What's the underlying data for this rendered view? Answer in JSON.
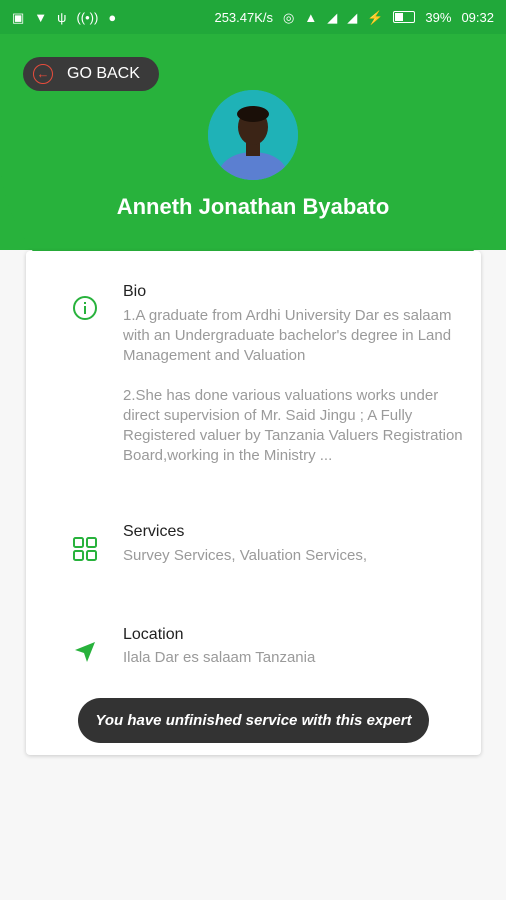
{
  "status_bar": {
    "network_speed": "253.47K/s",
    "battery_percent": "39%",
    "time": "09:32",
    "battery_level": 0.39,
    "left_icons": [
      "laptop-icon",
      "shield-icon",
      "usb-icon",
      "hotspot-icon",
      "android-icon"
    ],
    "right_icons": [
      "wifi-hotspot-icon",
      "bell-icon",
      "signal-icon",
      "signal-hd-icon",
      "charging-icon",
      "battery-icon"
    ]
  },
  "header": {
    "back_label": "GO BACK",
    "name": "Anneth Jonathan Byabato",
    "avatar_icon": "profile-photo"
  },
  "profile": {
    "bio": {
      "title": "Bio",
      "icon": "info-icon",
      "paragraph1": "1.A graduate from Ardhi University Dar es salaam with an Undergraduate bachelor's degree in Land Management and Valuation",
      "paragraph2": "2.She has done various valuations works under direct supervision of Mr. Said Jingu ; A Fully Registered valuer by Tanzania Valuers Registration Board,working in  the Ministry ..."
    },
    "services": {
      "title": "Services",
      "icon": "grid-icon",
      "text": "Survey Services, Valuation Services,"
    },
    "location": {
      "title": "Location",
      "icon": "navigation-icon",
      "text": "Ilala Dar es salaam Tanzania"
    }
  },
  "toast": {
    "message": "You have unfinished service with this expert"
  },
  "colors": {
    "brand_green": "#28b23c",
    "status_green": "#21a83a",
    "toast_bg": "#333333",
    "accent_red": "#e74c3c"
  }
}
